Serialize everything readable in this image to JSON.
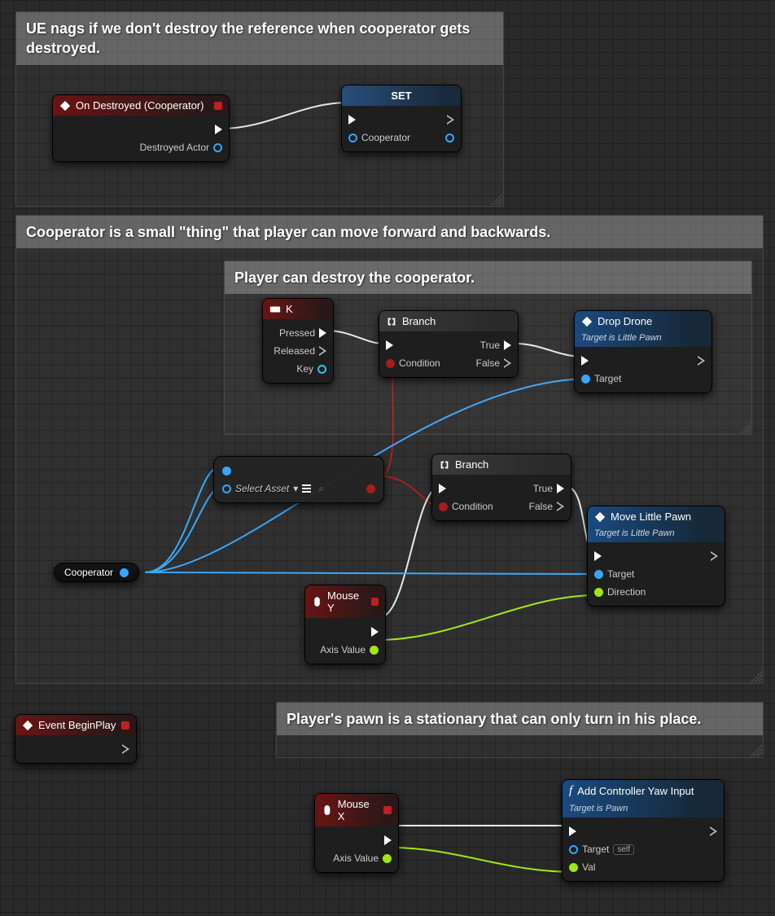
{
  "comments": {
    "c1": "UE nags if we don't destroy the reference when cooperator gets destroyed.",
    "c2": "Cooperator is a small \"thing\" that player can move forward and backwards.",
    "c3": "Player can destroy the cooperator.",
    "c4": "Player's pawn is a stationary that can only turn in his place."
  },
  "nodes": {
    "onDestroyed": {
      "title": "On Destroyed (Cooperator)",
      "out1": "Destroyed Actor"
    },
    "set": {
      "title": "SET",
      "pin": "Cooperator"
    },
    "k": {
      "title": "K",
      "pressed": "Pressed",
      "released": "Released",
      "key": "Key"
    },
    "branch1": {
      "title": "Branch",
      "condition": "Condition",
      "t": "True",
      "f": "False"
    },
    "branch2": {
      "title": "Branch",
      "condition": "Condition",
      "t": "True",
      "f": "False"
    },
    "dropDrone": {
      "title": "Drop Drone",
      "sub": "Target is Little Pawn",
      "target": "Target"
    },
    "moveLP": {
      "title": "Move Little Pawn",
      "sub": "Target is Little Pawn",
      "target": "Target",
      "dir": "Direction"
    },
    "asset": {
      "label": "Select Asset"
    },
    "coop": {
      "label": "Cooperator"
    },
    "mouseY": {
      "title": "Mouse Y",
      "axis": "Axis Value"
    },
    "mouseX": {
      "title": "Mouse X",
      "axis": "Axis Value"
    },
    "beginPlay": {
      "title": "Event BeginPlay"
    },
    "addYaw": {
      "title": "Add Controller Yaw Input",
      "sub": "Target is Pawn",
      "target": "Target",
      "val": "Val",
      "self": "self"
    }
  }
}
